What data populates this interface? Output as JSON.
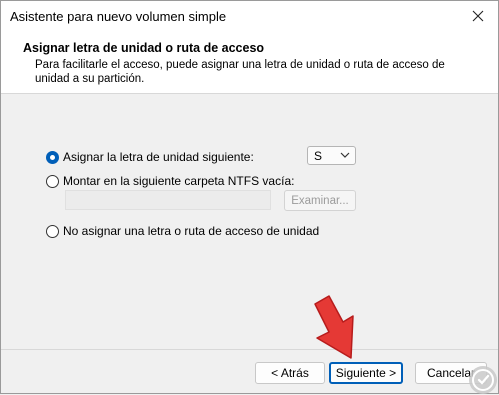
{
  "window": {
    "title": "Asistente para nuevo volumen simple"
  },
  "header": {
    "title": "Asignar letra de unidad o ruta de acceso",
    "description": "Para facilitarle el acceso, puede asignar una letra de unidad o ruta de acceso de unidad a su partición."
  },
  "options": {
    "assign_letter": {
      "label": "Asignar la letra de unidad siguiente:",
      "selected": true
    },
    "drive_letter": {
      "value": "S"
    },
    "mount_folder": {
      "label": "Montar en la siguiente carpeta NTFS vacía:",
      "selected": false
    },
    "mount_path": {
      "value": ""
    },
    "browse_label": "Examinar...",
    "no_assign": {
      "label": "No asignar una letra o ruta de acceso de unidad",
      "selected": false
    }
  },
  "footer": {
    "back_label": "< Atrás",
    "next_label": "Siguiente >",
    "cancel_label": "Cancelar"
  },
  "colors": {
    "accent": "#005fb8",
    "arrow": "#e53935"
  },
  "icons": [
    "close-icon",
    "chevron-down-icon",
    "pointer-arrow-icon",
    "logo-watermark-icon"
  ]
}
